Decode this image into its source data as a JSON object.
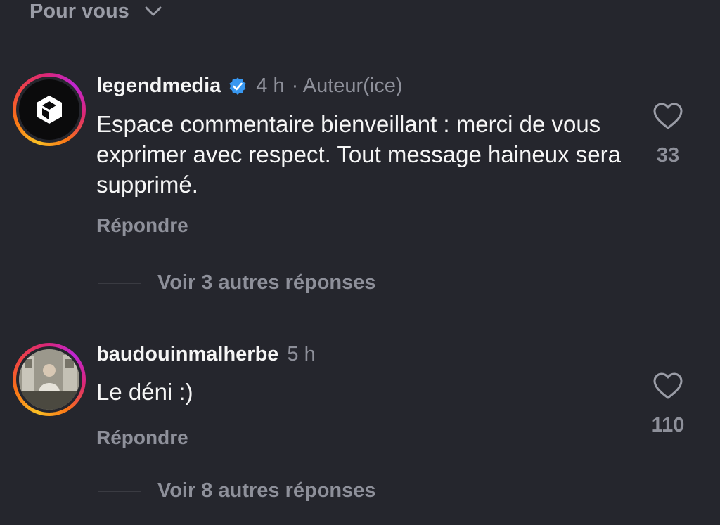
{
  "filter": {
    "label": "Pour vous",
    "icon": "chevron-down-icon"
  },
  "comments": [
    {
      "username": "legendmedia",
      "verified": true,
      "time": "4 h",
      "role": "· Auteur(ice)",
      "text": "Espace commentaire bienveillant : merci de vous exprimer avec respect. Tout message haineux sera supprimé.",
      "reply_label": "Répondre",
      "likes": "33",
      "more_replies": "Voir 3 autres réponses"
    },
    {
      "username": "baudouinmalherbe",
      "verified": false,
      "time": "5 h",
      "text": "Le déni :)",
      "reply_label": "Répondre",
      "likes": "110",
      "more_replies": "Voir 8 autres réponses"
    }
  ],
  "colors": {
    "background": "#25262d",
    "primary_text": "#f5f5f5",
    "secondary_text": "#8e909a",
    "verified_blue": "#3897f0"
  }
}
